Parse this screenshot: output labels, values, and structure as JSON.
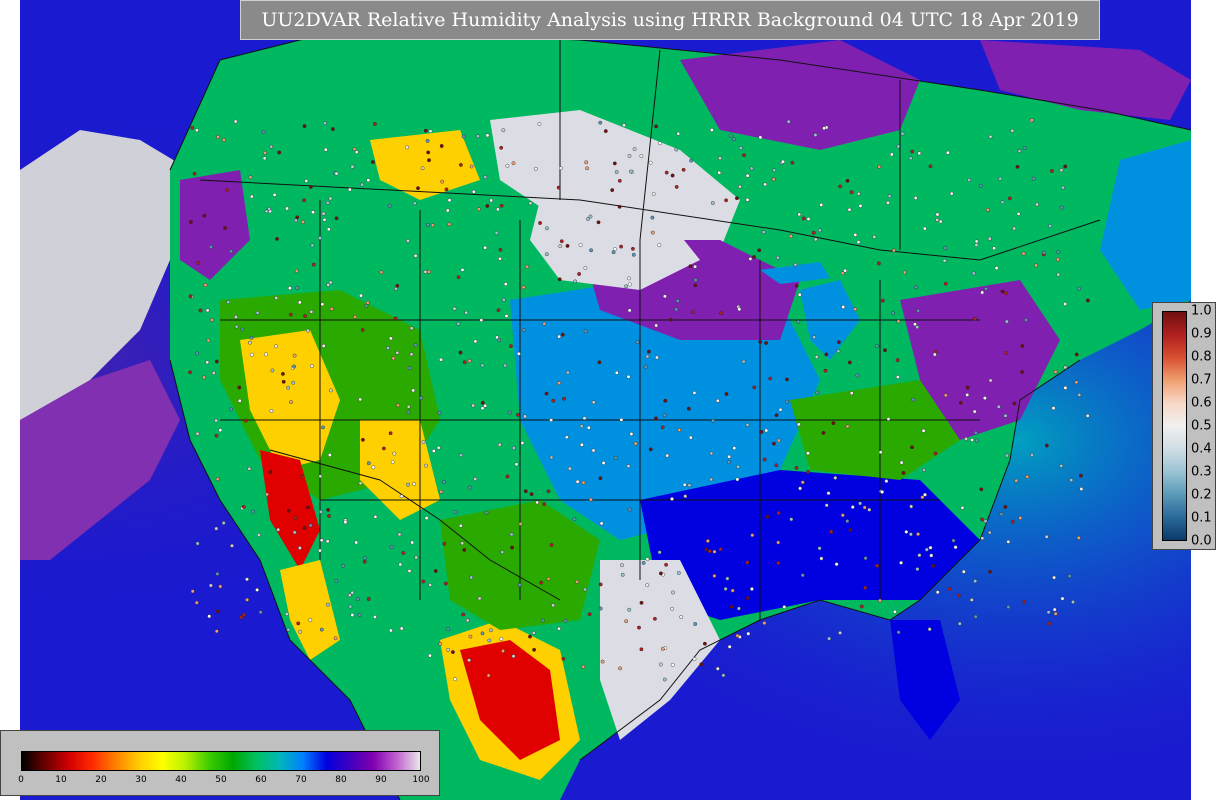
{
  "title": "UU2DVAR Relative Humidity Analysis using HRRR Background 04 UTC 18 Apr 2019",
  "legends": {
    "humidity": {
      "ticks": [
        "0",
        "10",
        "20",
        "30",
        "40",
        "50",
        "60",
        "70",
        "80",
        "90",
        "100"
      ],
      "range": [
        0,
        100
      ],
      "colors": [
        "#000000",
        "#6a0000",
        "#d00000",
        "#ff2a00",
        "#ff8000",
        "#ffcc00",
        "#ffff00",
        "#b8f000",
        "#3ccc00",
        "#00a800",
        "#00c060",
        "#00b8b8",
        "#0080ff",
        "#0000e0",
        "#4000c0",
        "#8000b0",
        "#c060d0",
        "#e8e8e8"
      ]
    },
    "uncertainty": {
      "ticks": [
        "1.0",
        "0.9",
        "0.8",
        "0.7",
        "0.6",
        "0.5",
        "0.4",
        "0.3",
        "0.2",
        "0.1",
        "0.0"
      ],
      "range": [
        0,
        1
      ],
      "colors": [
        "#0a3a6a",
        "#2a6a9a",
        "#5a9ab8",
        "#9ac4d4",
        "#d0dde4",
        "#f0f0f0",
        "#f8d8c8",
        "#f0a070",
        "#d85030",
        "#b02020",
        "#701010"
      ]
    }
  },
  "map": {
    "land_color": "#00b860",
    "ocean_color": "#1a1ad0",
    "region_colors": {
      "dry_core": "#e00000",
      "dry_mid": "#ffd000",
      "moist": "#2aaa00",
      "humid": "#0090e0",
      "very_humid": "#8020b0",
      "saturated": "#d8d8e0"
    }
  }
}
